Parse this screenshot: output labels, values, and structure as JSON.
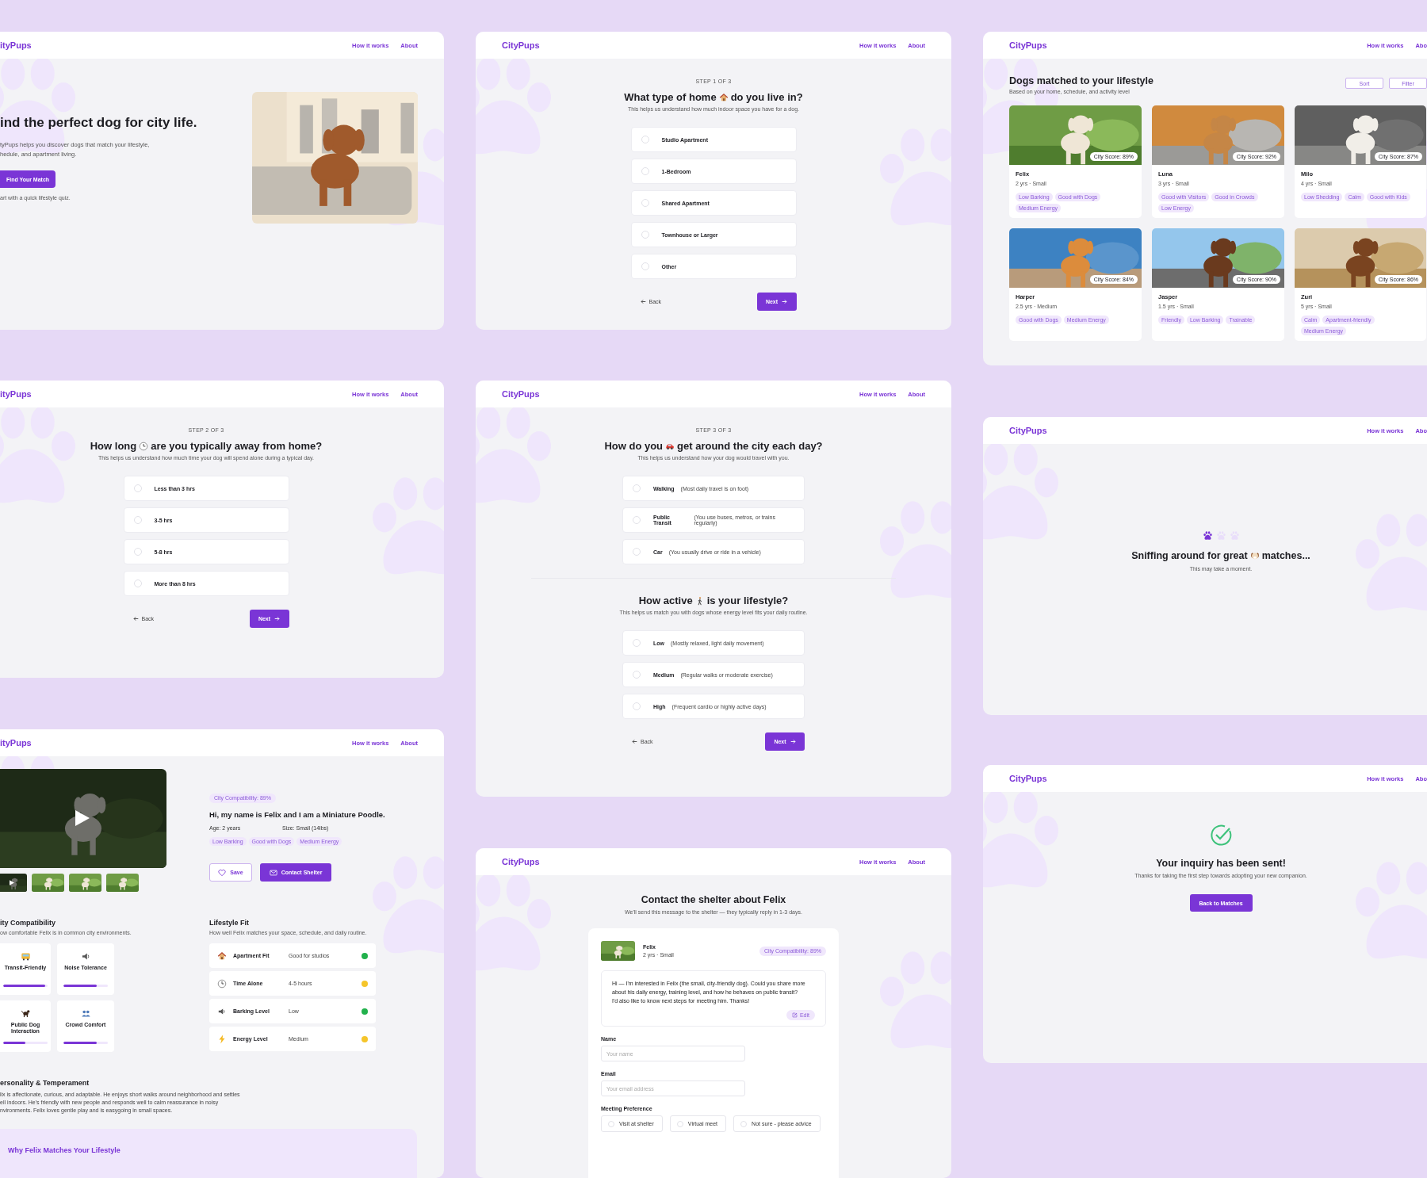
{
  "screens": [
    {
      "kind": "landing",
      "header": {
        "logo": "ityPups",
        "nav": [
          "How it works",
          "About"
        ]
      },
      "headline": "ind the perfect dog for city life.",
      "description_lines": [
        "tyPups helps you discover dogs that match your lifestyle,",
        "hedule, and apartment living."
      ],
      "cta": "Find Your Match",
      "note": "art with a quick lifestyle quiz."
    },
    {
      "kind": "quiz",
      "header": {
        "logo": "CityPups",
        "nav": [
          "How it works",
          "About"
        ]
      },
      "step": "STEP 1 OF 3",
      "questions": [
        {
          "title_start": "What type of home",
          "title_end": "do you live in?",
          "subtitle": "This helps us understand how much indoor space you have for a dog.",
          "options": [
            {
              "label": "Studio Apartment",
              "selected": false
            },
            {
              "label": "1-Bedroom",
              "selected": false
            },
            {
              "label": "Shared Apartment",
              "selected": false
            },
            {
              "label": "Townhouse or Larger",
              "selected": false
            },
            {
              "label": "Other",
              "selected": false
            }
          ]
        }
      ],
      "back": "Back",
      "next": "Next"
    },
    {
      "kind": "results",
      "header": {
        "logo": "CityPups",
        "nav": [
          "How it works",
          "Abo"
        ]
      },
      "title": "Dogs matched to your lifestyle",
      "subtitle": "Based on your home, schedule, and activity level",
      "actions": [
        "Sort",
        "Filter"
      ],
      "dogs": [
        {
          "name": "Felix",
          "meta": "2 yrs · Small",
          "score": "City Score: 89%",
          "tags": [
            "Low Barking",
            "Good with Dogs",
            "Medium Energy"
          ]
        },
        {
          "name": "Luna",
          "meta": "3 yrs · Small",
          "score": "City Score: 92%",
          "tags": [
            "Good with Visitors",
            "Good in Crowds",
            "Low Energy"
          ]
        },
        {
          "name": "Milo",
          "meta": "4 yrs · Small",
          "score": "City Score: 87%",
          "tags": [
            "Low Shedding",
            "Calm",
            "Good with Kids"
          ]
        },
        {
          "name": "Harper",
          "meta": "2.5 yrs · Medium",
          "score": "City Score: 84%",
          "tags": [
            "Good with Dogs",
            "Medium Energy"
          ]
        },
        {
          "name": "Jasper",
          "meta": "1.5 yrs · Small",
          "score": "City Score: 90%",
          "tags": [
            "Friendly",
            "Low Barking",
            "Trainable"
          ]
        },
        {
          "name": "Zuri",
          "meta": "5 yrs · Small",
          "score": "City Score: 86%",
          "tags": [
            "Calm",
            "Apartment-friendly",
            "Medium Energy"
          ]
        }
      ]
    },
    {
      "kind": "quiz",
      "header": {
        "logo": "ityPups",
        "nav": [
          "How it works",
          "About"
        ]
      },
      "step": "STEP 2 OF 3",
      "questions": [
        {
          "title_start": "How long",
          "title_end": "are you typically away from home?",
          "subtitle": "This helps us understand how much time your dog will spend alone during a typical day.",
          "options": [
            {
              "label": "Less than 3 hrs",
              "selected": false
            },
            {
              "label": "3-5 hrs",
              "selected": false
            },
            {
              "label": "5-8 hrs",
              "selected": false
            },
            {
              "label": "More than 8 hrs",
              "selected": false
            }
          ]
        }
      ],
      "back": "Back",
      "next": "Next"
    },
    {
      "kind": "quiz",
      "header": {
        "logo": "CityPups",
        "nav": [
          "How it works",
          "About"
        ]
      },
      "step": "STEP 3 OF 3",
      "questions": [
        {
          "title_start": "How do you",
          "title_end": "get around the city each day?",
          "subtitle": "This helps us understand how your dog would travel with you.",
          "options": [
            {
              "label": "Walking",
              "detail": "(Most daily travel is on foot)",
              "selected": false
            },
            {
              "label": "Public Transit",
              "detail": "(You use buses, metros, or trains regularly)",
              "selected": false
            },
            {
              "label": "Car",
              "detail": "(You usually drive or ride in a vehicle)",
              "selected": false
            }
          ]
        },
        {
          "title_start": "How active",
          "title_end": "is your lifestyle?",
          "subtitle": "This helps us match you with dogs whose energy level fits your daily routine.",
          "options": [
            {
              "label": "Low",
              "detail": "(Mostly relaxed, light daily movement)",
              "selected": false
            },
            {
              "label": "Medium",
              "detail": "(Regular walks or moderate exercise)",
              "selected": false
            },
            {
              "label": "High",
              "detail": "(Frequent cardio or highly active days)",
              "selected": false
            }
          ]
        }
      ],
      "back": "Back",
      "next": "Next"
    },
    {
      "kind": "loading",
      "header": {
        "logo": "CityPups",
        "nav": [
          "How it works",
          "Abo"
        ]
      },
      "progress": [
        {
          "active": true
        },
        {
          "active": false
        },
        {
          "active": false
        }
      ],
      "title_start": "Sniffing around for great",
      "title_end": "matches...",
      "subtitle": "This may take a moment."
    },
    {
      "kind": "detail",
      "header": {
        "logo": "ityPups",
        "nav": [
          "How it works",
          "About"
        ]
      },
      "badge": "City Compatibility: 89%",
      "title": "Hi, my name is Felix and I am a Miniature Poodle.",
      "facts": [
        "Age: 2 years",
        "Size: Small (14lbs)"
      ],
      "tags": [
        "Low Barking",
        "Good with Dogs",
        "Medium Energy"
      ],
      "actions": [
        "Save",
        "Contact Shelter"
      ],
      "compatibility": {
        "title": "ity Compatibility",
        "subtitle": "ow comfortable Felix is in common city environments.",
        "items": [
          {
            "label": "Transit-Friendly",
            "level": 0.95
          },
          {
            "label": "Noise Tolerance",
            "level": 0.75
          },
          {
            "label": "Public Dog Interaction",
            "level": 0.5
          },
          {
            "label": "Crowd Comfort",
            "level": 0.75
          }
        ]
      },
      "lifestyle": {
        "title": "Lifestyle Fit",
        "subtitle": "How well Felix matches your space, schedule, and daily routine.",
        "rows": [
          {
            "label": "Apartment Fit",
            "value": "Good for studios",
            "color": "#22b14c"
          },
          {
            "label": "Time Alone",
            "value": "4-5 hours",
            "color": "#f5c52b"
          },
          {
            "label": "Barking Level",
            "value": "Low",
            "color": "#22b14c"
          },
          {
            "label": "Energy Level",
            "value": "Medium",
            "color": "#f5c52b"
          }
        ]
      },
      "personality": {
        "title": "ersonality & Temperament",
        "lines": [
          "lix is affectionate, curious, and adaptable. He enjoys short walks around neighborhood and settles",
          "ell indoors. He's friendly with new people and responds well to calm reassurance in noisy",
          "nvironments. Felix loves gentle play and is easygoing in small spaces."
        ]
      },
      "why": {
        "title": "Why Felix Matches Your Lifestyle"
      }
    },
    {
      "kind": "contact",
      "header": {
        "logo": "CityPups",
        "nav": [
          "How it works",
          "About"
        ]
      },
      "title": "Contact the shelter about Felix",
      "subtitle": "We'll send this message to the shelter — they typically reply in 1-3 days.",
      "dog": {
        "name": "Felix",
        "meta": "2 yrs · Small",
        "badge": "City Compatibility: 89%"
      },
      "message": [
        "Hi — I'm interested in Felix (the small, city-friendly dog). Could you share more about his daily energy, training level, and how he behaves on public transit?",
        "I'd also like to know next steps for meeting him. Thanks!"
      ],
      "edit": "Edit",
      "fields": [
        {
          "label": "Name",
          "placeholder": "Your name"
        },
        {
          "label": "Email",
          "placeholder": "Your email address"
        }
      ],
      "preference": {
        "label": "Meeting Preference",
        "options": [
          {
            "label": "Visit at shelter",
            "selected": false
          },
          {
            "label": "Virtual meet",
            "selected": false
          },
          {
            "label": "Not sure - please advice",
            "selected": false
          }
        ]
      }
    },
    {
      "kind": "sent",
      "header": {
        "logo": "CityPups",
        "nav": [
          "How it works",
          "Abo"
        ]
      },
      "title": "Your inquiry has been sent!",
      "subtitle": "Thanks for taking the first step towards adopting your new companion.",
      "button": "Back to Matches"
    }
  ]
}
